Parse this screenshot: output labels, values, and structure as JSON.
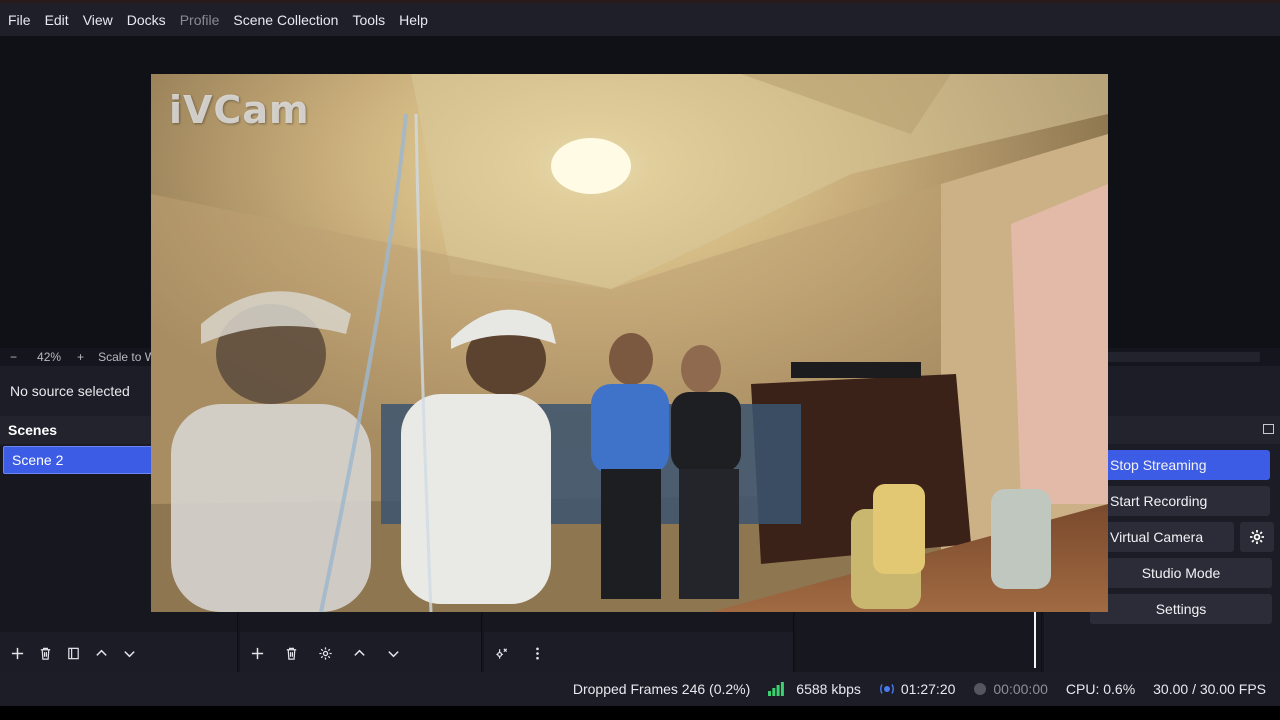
{
  "menu": {
    "items": [
      {
        "label": "File"
      },
      {
        "label": "Edit"
      },
      {
        "label": "View"
      },
      {
        "label": "Docks"
      },
      {
        "label": "Profile",
        "disabled": true
      },
      {
        "label": "Scene Collection"
      },
      {
        "label": "Tools"
      },
      {
        "label": "Help"
      }
    ]
  },
  "preview": {
    "zoom_minus": "−",
    "zoom_level": "42%",
    "zoom_plus": "+",
    "scale_label": "Scale to Wi",
    "watermark": "iVCam"
  },
  "source_bar": {
    "text": "No source selected"
  },
  "scenes": {
    "title": "Scenes",
    "items": [
      {
        "label": "Scene 2",
        "selected": true
      }
    ]
  },
  "controls": {
    "stop_streaming": "Stop Streaming",
    "start_recording": "Start Recording",
    "virtual_camera": "Virtual Camera",
    "studio_mode": "Studio Mode",
    "settings": "Settings"
  },
  "status": {
    "dropped_frames": "Dropped Frames 246 (0.2%)",
    "bitrate": "6588 kbps",
    "stream_time": "01:27:20",
    "record_time": "00:00:00",
    "cpu": "CPU: 0.6%",
    "fps": "30.00 / 30.00 FPS"
  },
  "colors": {
    "accent": "#3d5ce5",
    "signal_green": "#3bd16f",
    "live_blue": "#4a7bf2"
  },
  "icons": [
    "plus-icon",
    "trash-icon",
    "filter-icon",
    "arrow-up-icon",
    "arrow-down-icon",
    "gear-icon",
    "mixer-settings-icon",
    "kebab-menu-icon",
    "signal-bars-icon",
    "streaming-dot-icon",
    "recording-dot-icon",
    "float-dock-icon"
  ]
}
